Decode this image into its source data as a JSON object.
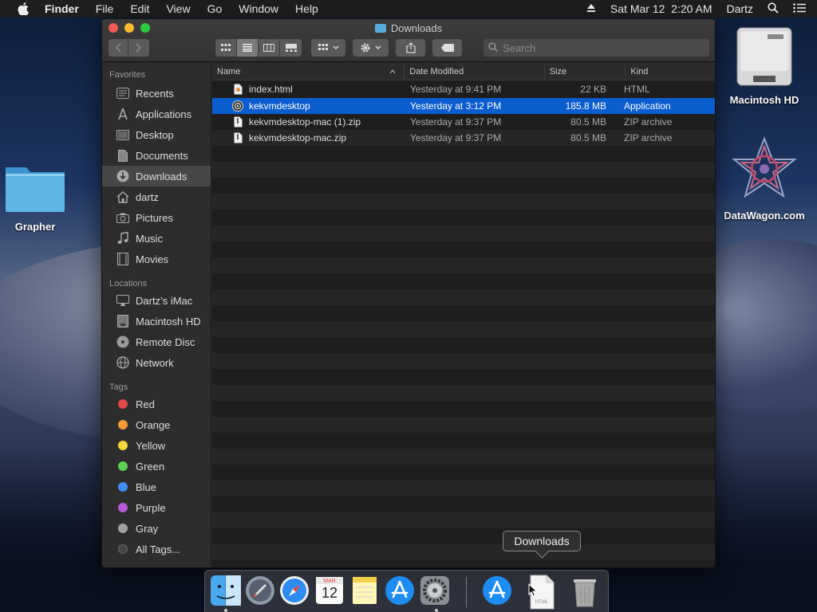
{
  "menubar": {
    "app": "Finder",
    "items": [
      "File",
      "Edit",
      "View",
      "Go",
      "Window",
      "Help"
    ],
    "datetime": "Sat Mar 12  2:20 AM",
    "user": "Dartz",
    "icons": [
      "apple-icon",
      "eject-icon",
      "search-icon",
      "menu-list-icon"
    ]
  },
  "desktop": {
    "icons": [
      {
        "label": "Grapher",
        "icon": "folder-icon"
      },
      {
        "label": "Macintosh HD",
        "icon": "hard-drive-icon"
      },
      {
        "label": "DataWagon.com",
        "icon": "star-logo-icon"
      }
    ]
  },
  "window": {
    "title": "Downloads",
    "search_placeholder": "Search",
    "toolbar": [
      "back-icon",
      "forward-icon",
      "icon-view-icon",
      "list-view-icon",
      "column-view-icon",
      "gallery-view-icon",
      "group-icon",
      "gear-icon",
      "share-icon",
      "tag-icon"
    ],
    "sidebar": {
      "favorites_header": "Favorites",
      "favorites": [
        {
          "label": "Recents",
          "icon": "clock-icon"
        },
        {
          "label": "Applications",
          "icon": "applications-icon"
        },
        {
          "label": "Desktop",
          "icon": "desktop-icon"
        },
        {
          "label": "Documents",
          "icon": "document-icon"
        },
        {
          "label": "Downloads",
          "icon": "download-icon",
          "selected": true
        },
        {
          "label": "dartz",
          "icon": "home-icon"
        },
        {
          "label": "Pictures",
          "icon": "camera-icon"
        },
        {
          "label": "Music",
          "icon": "music-note-icon"
        },
        {
          "label": "Movies",
          "icon": "film-icon"
        }
      ],
      "locations_header": "Locations",
      "locations": [
        {
          "label": "Dartz’s iMac",
          "icon": "imac-icon"
        },
        {
          "label": "Macintosh HD",
          "icon": "disk-icon"
        },
        {
          "label": "Remote Disc",
          "icon": "disc-icon"
        },
        {
          "label": "Network",
          "icon": "globe-icon"
        }
      ],
      "tags_header": "Tags",
      "tags": [
        {
          "label": "Red",
          "color": "#e0464a"
        },
        {
          "label": "Orange",
          "color": "#f19a38"
        },
        {
          "label": "Yellow",
          "color": "#f4d83a"
        },
        {
          "label": "Green",
          "color": "#5fcf4f"
        },
        {
          "label": "Blue",
          "color": "#3f8cf0"
        },
        {
          "label": "Purple",
          "color": "#b65ad8"
        },
        {
          "label": "Gray",
          "color": "#a0a0a0"
        },
        {
          "label": "All Tags...",
          "color": "#444444"
        }
      ]
    },
    "columns": {
      "name": "Name",
      "date": "Date Modified",
      "size": "Size",
      "kind": "Kind"
    },
    "files": [
      {
        "name": "index.html",
        "date": "Yesterday at 9:41 PM",
        "size": "22 KB",
        "kind": "HTML",
        "icon": "html-file-icon"
      },
      {
        "name": "kekvmdesktop",
        "date": "Yesterday at 3:12 PM",
        "size": "185.8 MB",
        "kind": "Application",
        "icon": "app-icon",
        "selected": true
      },
      {
        "name": "kekvmdesktop-mac (1).zip",
        "date": "Yesterday at 9:37 PM",
        "size": "80.5 MB",
        "kind": "ZIP archive",
        "icon": "zip-file-icon"
      },
      {
        "name": "kekvmdesktop-mac.zip",
        "date": "Yesterday at 9:37 PM",
        "size": "80.5 MB",
        "kind": "ZIP archive",
        "icon": "zip-file-icon"
      }
    ]
  },
  "tooltip": "Downloads",
  "dock": {
    "calendar_month": "MAR",
    "calendar_day": "12",
    "html_label": "HTML",
    "apps": [
      "finder-icon",
      "launchpad-icon",
      "safari-icon",
      "calendar-icon",
      "notes-icon",
      "app-store-icon",
      "system-preferences-icon",
      "app-store-downloads-icon",
      "html-document-icon",
      "trash-icon"
    ]
  }
}
